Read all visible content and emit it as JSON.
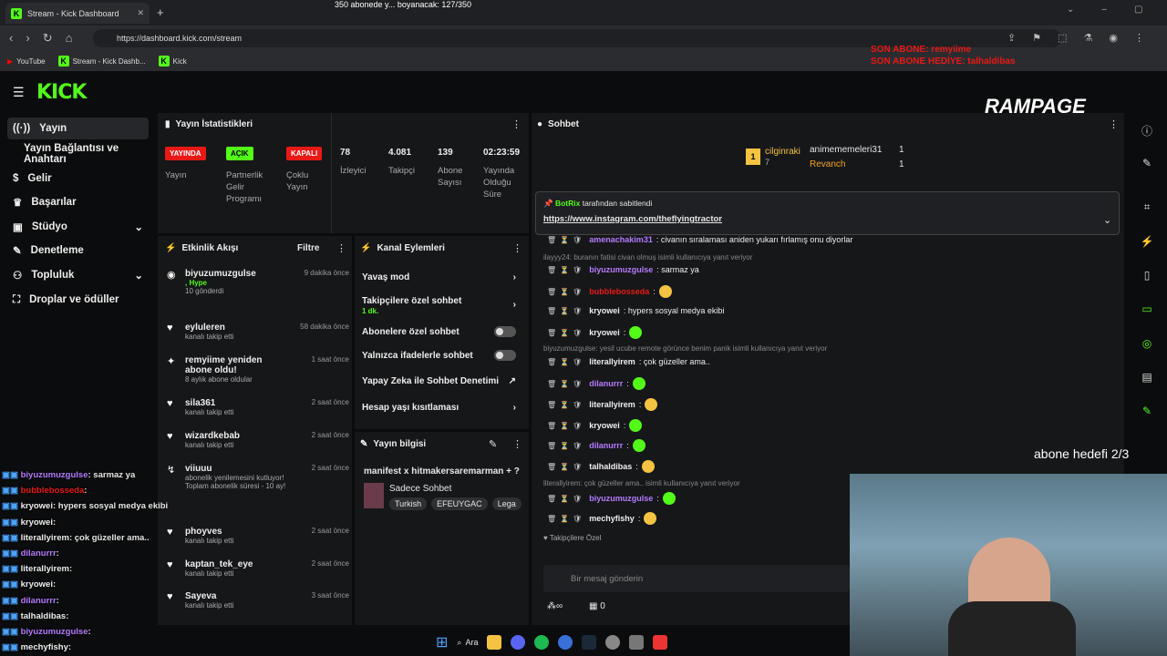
{
  "browser": {
    "tab_title": "Stream - Kick Dashboard",
    "url": "https://dashboard.kick.com/stream",
    "bookmarks": [
      "YouTube",
      "Stream - Kick Dashb...",
      "Kick"
    ]
  },
  "overlay": {
    "sub_goal_text": "350 abonede y... boyanacak: 127/350",
    "last_sub": "SON ABONE: remyiime",
    "last_gift": "SON ABONE HEDİYE: talhaldibas",
    "brand": "RAMPAGE",
    "sub_goal": "abone hedefi 2/3"
  },
  "sidebar": {
    "items": [
      {
        "label": "Yayın",
        "icon": "broadcast-icon"
      },
      {
        "label": "Yayın Bağlantısı ve Anahtarı",
        "icon": ""
      },
      {
        "label": "Gelir",
        "icon": "dollar-icon"
      },
      {
        "label": "Başarılar",
        "icon": "trophy-icon"
      },
      {
        "label": "Stüdyo",
        "icon": "studio-icon"
      },
      {
        "label": "Denetleme",
        "icon": "wrench-icon"
      },
      {
        "label": "Topluluk",
        "icon": "community-icon"
      },
      {
        "label": "Droplar ve ödüller",
        "icon": "gift-icon"
      }
    ]
  },
  "stats": {
    "title": "Yayın İstatistikleri",
    "badges": [
      {
        "text": "YAYINDA",
        "label": "Yayın",
        "color": "#e91916"
      },
      {
        "text": "AÇIK",
        "label": "Partnerlik Gelir Programı",
        "color": "#53fc18"
      },
      {
        "text": "KAPALI",
        "label": "Çoklu Yayın",
        "color": "#e91916"
      }
    ],
    "values": [
      {
        "value": "78",
        "label": "İzleyici"
      },
      {
        "value": "4.081",
        "label": "Takipçi"
      },
      {
        "value": "139",
        "label": "Abone Sayısı"
      },
      {
        "value": "02:23:59",
        "label": "Yayında Olduğu Süre"
      }
    ]
  },
  "activity": {
    "title": "Etkinlik Akışı",
    "filter": "Filtre",
    "items": [
      {
        "name": "biyuzumuzgulse",
        "sub": "10 gönderdi",
        "time": "9 dakika önce"
      },
      {
        "name": "eyluleren",
        "sub": "kanalı takip etti",
        "time": "58 dakika önce"
      },
      {
        "name": "remyiime yeniden abone oldu!",
        "sub": "8 aylık abone oldular",
        "time": "1 saat önce"
      },
      {
        "name": "sila361",
        "sub": "kanalı takip etti",
        "time": "2 saat önce"
      },
      {
        "name": "wizardkebab",
        "sub": "kanalı takip etti",
        "time": "2 saat önce"
      },
      {
        "name": "viiuuu",
        "sub": "abonelik yenilemesini kutluyor! Toplam abonelik süresi - 10 ay!",
        "time": "2 saat önce"
      },
      {
        "name": "phoyves",
        "sub": "kanalı takip etti",
        "time": "2 saat önce"
      },
      {
        "name": "kaptan_tek_eye",
        "sub": "kanalı takip etti",
        "time": "2 saat önce"
      },
      {
        "name": "Sayeva",
        "sub": "kanalı takip etti",
        "time": "3 saat önce"
      }
    ],
    "hype": ", Hype"
  },
  "channel_actions": {
    "title": "Kanal Eylemleri",
    "items": [
      "Yavaş mod",
      "Takipçilere özel sohbet",
      "Abonelere özel sohbet",
      "Yalnızca ifadelerle sohbet",
      "Yapay Zeka ile Sohbet Denetimi",
      "Hesap yaşı kısıtlaması"
    ],
    "follow_sub": "1 dk."
  },
  "stream_info": {
    "title": "Yayın bilgisi",
    "stream_title": "manifest x hitmakersaremarman + ?",
    "category": "Sadece Sohbet",
    "tags": [
      "Turkish",
      "EFEUYGAC",
      "Lega"
    ]
  },
  "chat": {
    "title": "Sohbet",
    "top": [
      {
        "name": "cilginraki",
        "count": "7"
      },
      {
        "name": "animememeleri31",
        "count": "1"
      },
      {
        "name": "Revanch",
        "count": "1"
      }
    ],
    "pinned_by": "BotRix",
    "pinned_text": "tarafından sabitlendi",
    "pinned_link": "https://www.instagram.com/theflyingtractor",
    "messages": [
      {
        "user": "amenachakim31",
        "color": "#b57bff",
        "text": ": civanın sıralaması aniden yukarı fırlamış onu diyorlar"
      },
      {
        "reply": "ilayyy24: buranın fatisi civan olmuş isimli kullanıcıya yanıt veriyor"
      },
      {
        "user": "biyuzumuzgulse",
        "color": "#b57bff",
        "text": ": sarmaz ya"
      },
      {
        "user": "bubblebosseda",
        "color": "#e91916",
        "text": ":"
      },
      {
        "user": "kryowei",
        "color": "#eee",
        "text": ": hypers sosyal medya ekibi"
      },
      {
        "user": "kryowei",
        "color": "#eee",
        "text": ":"
      },
      {
        "reply": "biyuzumuzgulse: yesil ucube remote görünce benim panik isimli kullanıcıya yanıt veriyor"
      },
      {
        "user": "literallyirem",
        "color": "#eee",
        "text": ": çok güzeller ama.."
      },
      {
        "user": "dilanurrr",
        "color": "#b57bff",
        "text": ":"
      },
      {
        "user": "literallyirem",
        "color": "#eee",
        "text": ":"
      },
      {
        "user": "kryowei",
        "color": "#eee",
        "text": ":"
      },
      {
        "user": "dilanurrr",
        "color": "#b57bff",
        "text": ":"
      },
      {
        "user": "talhaldibas",
        "color": "#eee",
        "text": ":"
      },
      {
        "reply": "literallyirem: çok güzeller ama.. isimli kullanıcıya yanıt veriyor"
      },
      {
        "user": "biyuzumuzgulse",
        "color": "#b57bff",
        "text": ":"
      },
      {
        "user": "mechyfishy",
        "color": "#eee",
        "text": ":"
      }
    ],
    "followers_only": "Takipçilere Özel",
    "placeholder": "Bir mesaj gönderin",
    "points": "0"
  },
  "overlay_chat": [
    {
      "user": "biyuzumuzgulse",
      "text": ": sarmaz ya",
      "color": "#b57bff"
    },
    {
      "user": "bubblebosseda",
      "text": ":",
      "color": "#e91916"
    },
    {
      "user": "kryowei",
      "text": ": hypers sosyal medya ekibi",
      "color": "#eee"
    },
    {
      "user": "kryowei",
      "text": ":",
      "color": "#eee"
    },
    {
      "user": "literallyirem",
      "text": ": çok güzeller ama..",
      "color": "#eee"
    },
    {
      "user": "dilanurrr",
      "text": ":",
      "color": "#b57bff"
    },
    {
      "user": "literallyirem",
      "text": ":",
      "color": "#eee"
    },
    {
      "user": "kryowei",
      "text": ":",
      "color": "#eee"
    },
    {
      "user": "dilanurrr",
      "text": ":",
      "color": "#b57bff"
    },
    {
      "user": "talhaldibas",
      "text": ":",
      "color": "#eee"
    },
    {
      "user": "biyuzumuzgulse",
      "text": ":",
      "color": "#b57bff"
    },
    {
      "user": "mechyfishy",
      "text": ":",
      "color": "#eee"
    }
  ],
  "taskbar": {
    "search": "Ara"
  }
}
